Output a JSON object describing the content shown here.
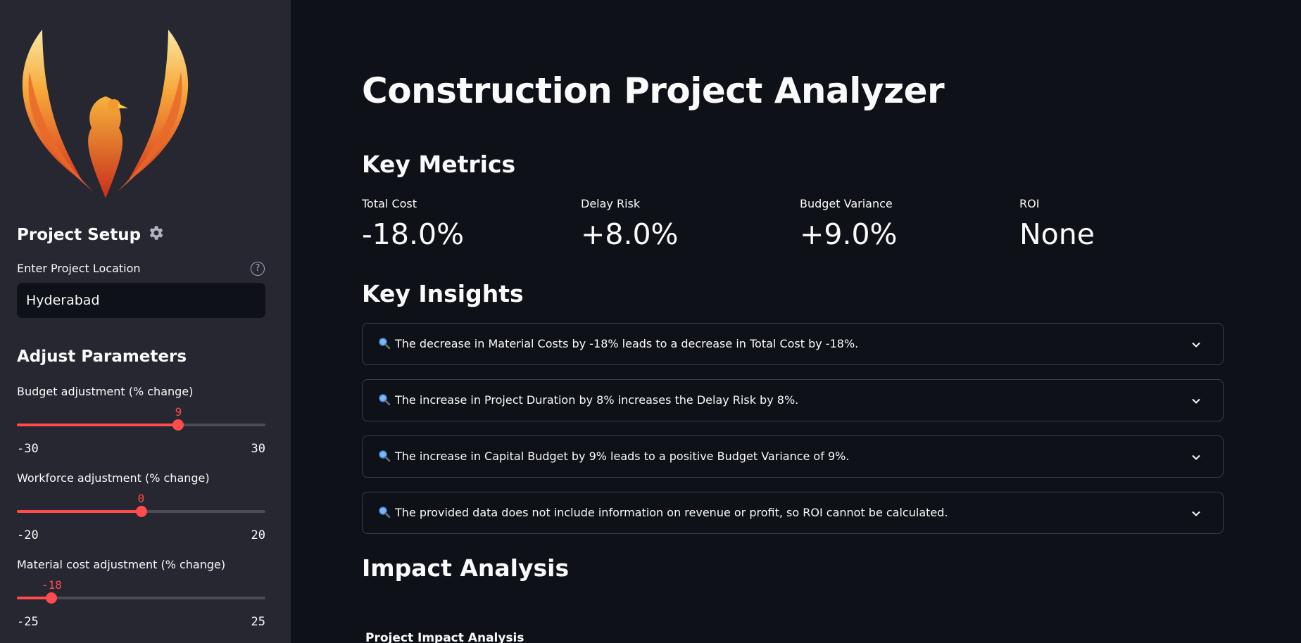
{
  "sidebar": {
    "logo_icon": "phoenix-logo",
    "setup_title": "Project Setup",
    "setup_icon": "gear-icon",
    "location_label": "Enter Project Location",
    "location_value": "Hyderabad",
    "help_icon": "question-circle-icon",
    "help_glyph": "?",
    "params_title": "Adjust Parameters",
    "sliders": [
      {
        "label": "Budget adjustment (% change)",
        "value": "9",
        "min": "-30",
        "max": "30",
        "level": 0.65
      },
      {
        "label": "Workforce adjustment (% change)",
        "value": "0",
        "min": "-20",
        "max": "20",
        "level": 0.5
      },
      {
        "label": "Material cost adjustment (% change)",
        "value": "-18",
        "min": "-25",
        "max": "25",
        "level": 0.14
      }
    ]
  },
  "main": {
    "title": "Construction Project Analyzer",
    "metrics_heading": "Key Metrics",
    "metrics": [
      {
        "label": "Total Cost",
        "value": "-18.0%"
      },
      {
        "label": "Delay Risk",
        "value": "+8.0%"
      },
      {
        "label": "Budget Variance",
        "value": "+9.0%"
      },
      {
        "label": "ROI",
        "value": "None"
      }
    ],
    "insights_heading": "Key Insights",
    "insights": [
      "The decrease in Material Costs by -18% leads to a decrease in Total Cost by -18%.",
      "The increase in Project Duration by 8% increases the Delay Risk by 8%.",
      "The increase in Capital Budget by 9% leads to a positive Budget Variance of 9%.",
      "The provided data does not include information on revenue or profit, so ROI cannot be calculated."
    ],
    "impact_heading": "Impact Analysis",
    "impact_subheading": "Project Impact Analysis"
  },
  "colors": {
    "accent": "#ff4b4b",
    "sidebar_bg": "#262730",
    "main_bg": "#0e1117"
  }
}
